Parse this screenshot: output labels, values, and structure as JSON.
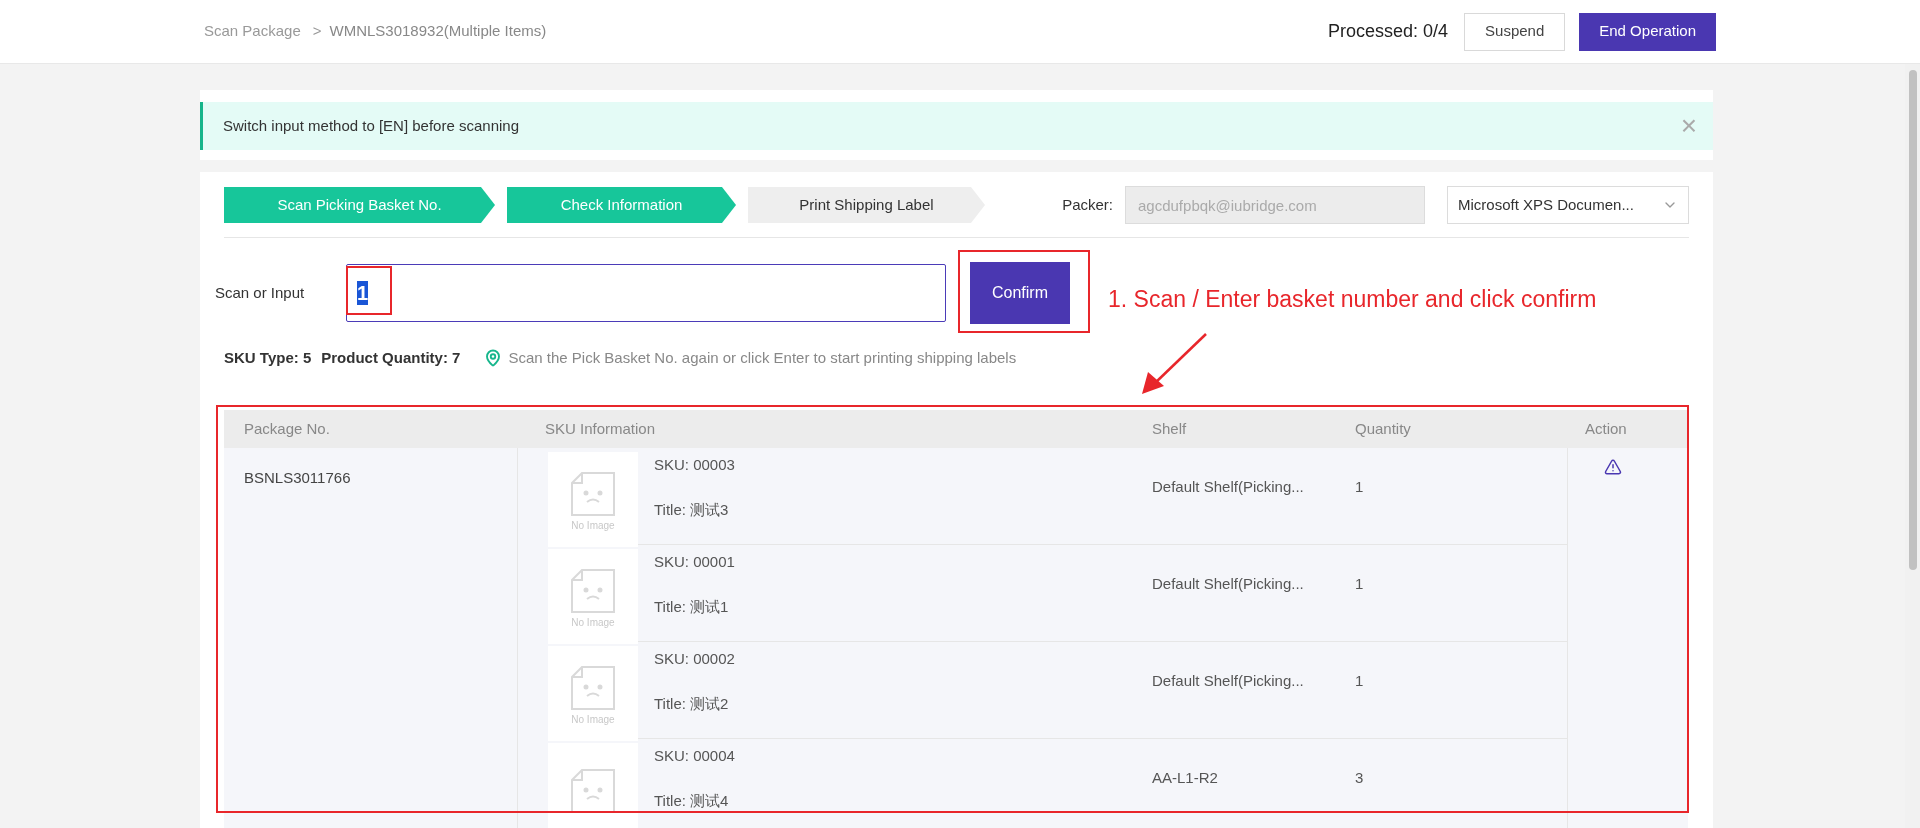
{
  "breadcrumb": {
    "parent": "Scan Package",
    "separator": ">",
    "current": "WMNLS3018932(Multiple Items)"
  },
  "header": {
    "processed": "Processed: 0/4",
    "suspend_button": "Suspend",
    "end_button": "End Operation"
  },
  "alert": {
    "message": "Switch input method to [EN] before scanning",
    "close_icon": "×"
  },
  "steps": [
    {
      "label": "Scan Picking Basket No.",
      "completed": true
    },
    {
      "label": "Check Information",
      "completed": true
    },
    {
      "label": "Print Shipping Label",
      "completed": false
    }
  ],
  "packer": {
    "label": "Packer:",
    "value": "agcdufpbqk@iubridge.com",
    "disabled": true
  },
  "printer": {
    "value": "Microsoft XPS Documen..."
  },
  "scan": {
    "label": "Scan or Input",
    "value": "1",
    "text_selected": true,
    "confirm_button": "Confirm"
  },
  "summary": {
    "sku_type": "SKU Type: 5",
    "product_quantity": "Product Quantity: 7",
    "hint": "Scan the Pick Basket No. again or click Enter to start printing shipping labels"
  },
  "annotation": {
    "text": "1. Scan / Enter basket number and click confirm"
  },
  "table": {
    "columns": [
      "Package No.",
      "SKU Information",
      "Shelf",
      "Quantity",
      "Action"
    ],
    "rows": [
      {
        "package_no": "BSNLS3011766",
        "items": [
          {
            "sku": "SKU: 00003",
            "title": "Title: 测试3",
            "shelf": "Default Shelf(Picking...",
            "quantity": "1",
            "image_label": "No Image"
          },
          {
            "sku": "SKU: 00001",
            "title": "Title: 测试1",
            "shelf": "Default Shelf(Picking...",
            "quantity": "1",
            "image_label": "No Image"
          },
          {
            "sku": "SKU: 00002",
            "title": "Title: 测试2",
            "shelf": "Default Shelf(Picking...",
            "quantity": "1",
            "image_label": "No Image"
          },
          {
            "sku": "SKU: 00004",
            "title": "Title: 测试4",
            "shelf": "AA-L1-R2",
            "quantity": "3"
          }
        ]
      }
    ]
  }
}
